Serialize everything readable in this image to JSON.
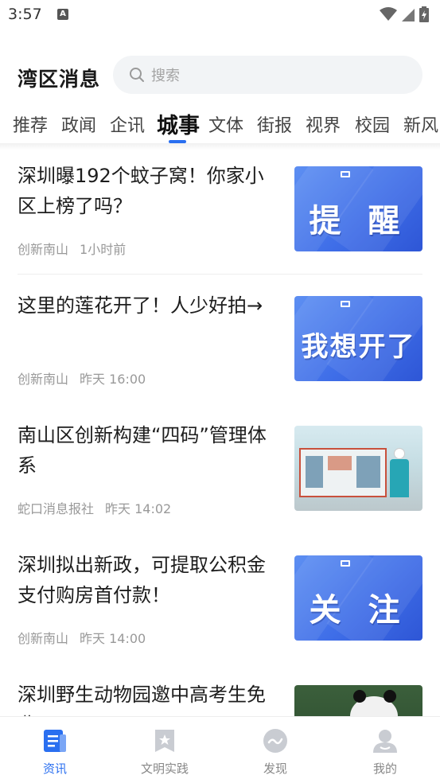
{
  "status_bar": {
    "time": "3:57"
  },
  "header": {
    "title": "湾区消息",
    "search_placeholder": "搜索"
  },
  "tabs": [
    {
      "label": "推荐"
    },
    {
      "label": "政闻"
    },
    {
      "label": "企讯"
    },
    {
      "label": "城事",
      "active": true
    },
    {
      "label": "文体"
    },
    {
      "label": "街报"
    },
    {
      "label": "视界"
    },
    {
      "label": "校园"
    },
    {
      "label": "新风"
    }
  ],
  "articles": [
    {
      "title": "深圳曝192个蚊子窝！你家小区上榜了吗？",
      "source": "创新南山",
      "time": "1小时前",
      "thumb_text": "提 醒"
    },
    {
      "title": "这里的莲花开了！人少好拍→",
      "source": "创新南山",
      "time": "昨天 16:00",
      "thumb_text": "我想开了"
    },
    {
      "title": "南山区创新构建“四码”管理体系",
      "source": "蛇口消息报社",
      "time": "昨天 14:02",
      "thumb_text": ""
    },
    {
      "title": "深圳拟出新政，可提取公积金支付购房首付款！",
      "source": "创新南山",
      "time": "昨天 14:00",
      "thumb_text": "关 注"
    },
    {
      "title": "深圳野生动物园邀中高考生免费",
      "source": "",
      "time": "",
      "thumb_text": ""
    }
  ],
  "bottom_nav": [
    {
      "label": "资讯",
      "active": true
    },
    {
      "label": "文明实践"
    },
    {
      "label": "发现"
    },
    {
      "label": "我的"
    }
  ],
  "colors": {
    "accent": "#2a6ff0",
    "thumb_blue": "#3f6ee8",
    "meta_gray": "#999999"
  }
}
